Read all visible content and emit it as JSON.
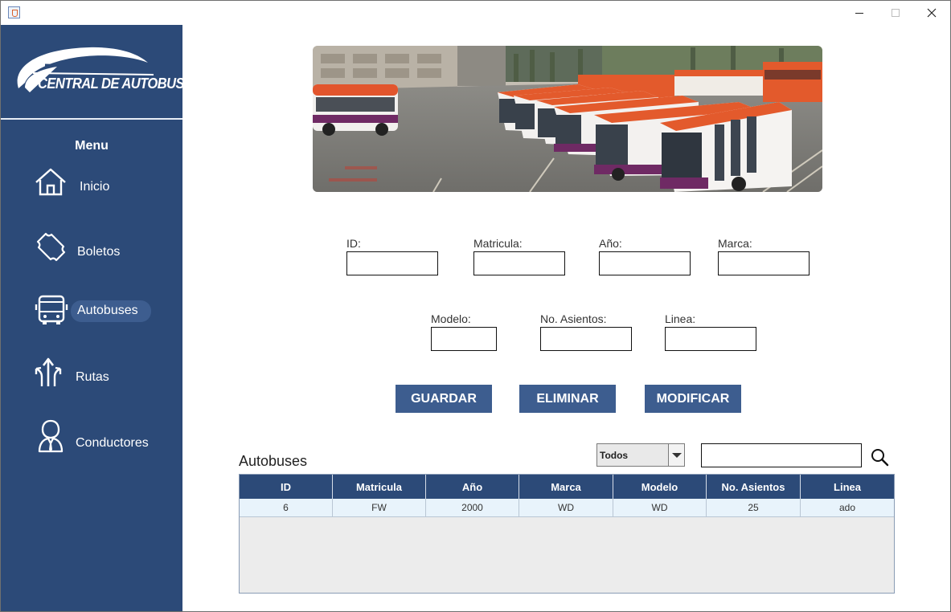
{
  "window": {
    "controls": {
      "minimize": "minimize",
      "maximize": "maximize",
      "close": "close"
    }
  },
  "sidebar": {
    "logo_text": "CENTRAL DE AUTOBUSES",
    "menu_title": "Menu",
    "items": [
      {
        "label": "Inicio",
        "icon": "home-icon"
      },
      {
        "label": "Boletos",
        "icon": "ticket-icon"
      },
      {
        "label": "Autobuses",
        "icon": "bus-icon",
        "active": true
      },
      {
        "label": "Rutas",
        "icon": "routes-icon"
      },
      {
        "label": "Conductores",
        "icon": "driver-icon"
      }
    ]
  },
  "banner": {
    "image": "bus-depot-photo"
  },
  "form": {
    "id_label": "ID:",
    "id_value": "",
    "matricula_label": "Matricula:",
    "matricula_value": "",
    "anio_label": "Año:",
    "anio_value": "",
    "marca_label": "Marca:",
    "marca_value": "",
    "modelo_label": "Modelo:",
    "modelo_value": "",
    "asientos_label": "No. Asientos:",
    "asientos_value": "",
    "linea_label": "Linea:",
    "linea_value": ""
  },
  "actions": {
    "save_label": "GUARDAR",
    "delete_label": "ELIMINAR",
    "modify_label": "MODIFICAR"
  },
  "table": {
    "title": "Autobuses",
    "filter_selected": "Todos",
    "search_value": "",
    "columns": [
      "ID",
      "Matricula",
      "Año",
      "Marca",
      "Modelo",
      "No. Asientos",
      "Linea"
    ],
    "rows": [
      [
        "6",
        "FW",
        "2000",
        "WD",
        "WD",
        "25",
        "ado"
      ]
    ]
  },
  "colors": {
    "sidebar": "#2c4a78",
    "accent": "#3d5d8f",
    "row_highlight": "#e8f3fb"
  }
}
